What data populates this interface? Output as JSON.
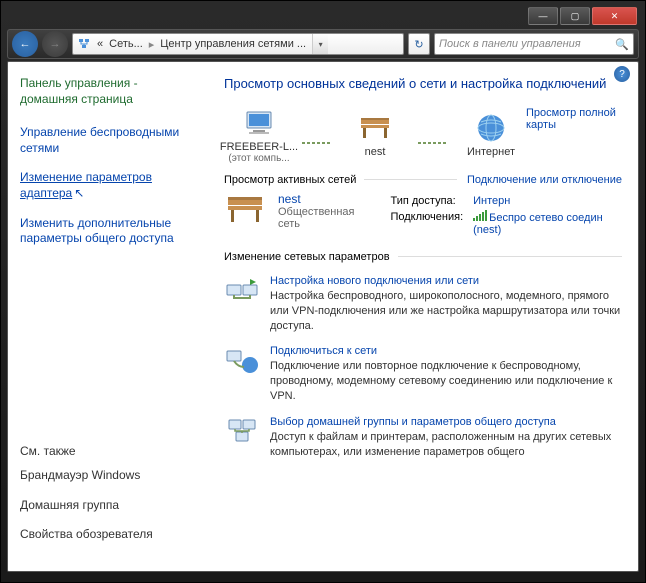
{
  "titlebar": {
    "min": "—",
    "max": "▢",
    "close": "✕"
  },
  "nav": {
    "back": "←",
    "fwd": "→",
    "refresh": "↻"
  },
  "breadcrumb": {
    "root": "Сеть...",
    "current": "Центр управления сетями ...",
    "sep": "▸"
  },
  "search": {
    "placeholder": "Поиск в панели управления",
    "icon": "🔍"
  },
  "help": "?",
  "sidebar": {
    "home": "Панель управления - домашняя страница",
    "links": [
      "Управление беспроводными сетями",
      "Изменение параметров адаптера",
      "Изменить дополнительные параметры общего доступа"
    ],
    "see_also": "См. также",
    "extras": [
      "Брандмауэр Windows",
      "Домашняя группа",
      "Свойства обозревателя"
    ]
  },
  "main": {
    "title": "Просмотр основных сведений о сети и настройка подключений",
    "map_link": "Просмотр полной карты",
    "nodes": {
      "pc": {
        "label": "FREEBEER-L...",
        "sub": "(этот компь..."
      },
      "router": {
        "label": "nest"
      },
      "internet": {
        "label": "Интернет"
      }
    },
    "active_section": "Просмотр активных сетей",
    "active_action": "Подключение или отключение",
    "network": {
      "name": "nest",
      "type": "Общественная сеть",
      "access_label": "Тип доступа:",
      "access_value": "Интерн",
      "conn_label": "Подключения:",
      "conn_value": "Беспро сетево соедин (nest)"
    },
    "settings_section": "Изменение сетевых параметров",
    "items": [
      {
        "title": "Настройка нового подключения или сети",
        "desc": "Настройка беспроводного, широкополосного, модемного, прямого или VPN-подключения или же настройка маршрутизатора или точки доступа."
      },
      {
        "title": "Подключиться к сети",
        "desc": "Подключение или повторное подключение к беспроводному, проводному, модемному сетевому соединению или подключение к VPN."
      },
      {
        "title": "Выбор домашней группы и параметров общего доступа",
        "desc": "Доступ к файлам и принтерам, расположенным на других сетевых компьютерах, или изменение параметров общего"
      }
    ]
  }
}
